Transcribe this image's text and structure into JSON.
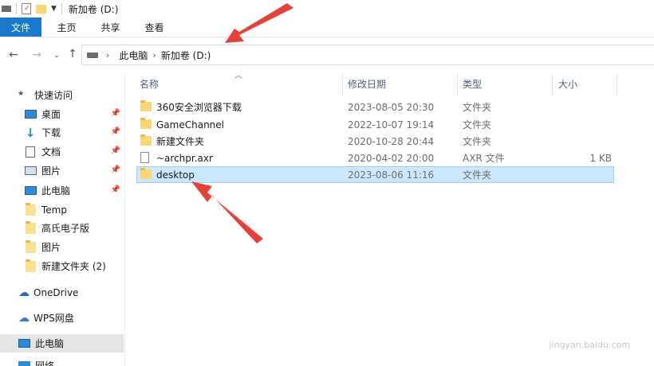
{
  "window": {
    "title": "新加卷 (D:)"
  },
  "ribbon": {
    "tabs": [
      {
        "label": "文件"
      },
      {
        "label": "主页"
      },
      {
        "label": "共享"
      },
      {
        "label": "查看"
      }
    ]
  },
  "address": {
    "segments": [
      "此电脑",
      "新加卷 (D:)"
    ]
  },
  "sidebar": {
    "quick_access": "快速访问",
    "items": [
      {
        "label": "桌面",
        "icon": "desktop-icon",
        "pinned": true
      },
      {
        "label": "下载",
        "icon": "download-icon",
        "pinned": true
      },
      {
        "label": "文档",
        "icon": "document-icon",
        "pinned": true
      },
      {
        "label": "图片",
        "icon": "pictures-icon",
        "pinned": true
      },
      {
        "label": "此电脑",
        "icon": "computer-icon",
        "pinned": true
      },
      {
        "label": "Temp",
        "icon": "folder-icon",
        "pinned": false
      },
      {
        "label": "高氏电子版",
        "icon": "folder-icon",
        "pinned": false
      },
      {
        "label": "图片",
        "icon": "folder-icon",
        "pinned": false
      },
      {
        "label": "新建文件夹 (2)",
        "icon": "folder-icon",
        "pinned": false
      }
    ],
    "onedrive": "OneDrive",
    "wps": "WPS网盘",
    "this_pc": "此电脑",
    "next_partial": "网络"
  },
  "columns": {
    "name": "名称",
    "date": "修改日期",
    "type": "类型",
    "size": "大小"
  },
  "files": [
    {
      "name": "360安全浏览器下载",
      "date": "2023-08-05 20:30",
      "type": "文件夹",
      "size": "",
      "kind": "folder"
    },
    {
      "name": "GameChannel",
      "date": "2022-10-07 19:14",
      "type": "文件夹",
      "size": "",
      "kind": "folder"
    },
    {
      "name": "新建文件夹",
      "date": "2020-10-28 20:44",
      "type": "文件夹",
      "size": "",
      "kind": "folder"
    },
    {
      "name": "~archpr.axr",
      "date": "2020-04-02 20:00",
      "type": "AXR 文件",
      "size": "1 KB",
      "kind": "file"
    },
    {
      "name": "desktop",
      "date": "2023-08-06 11:16",
      "type": "文件夹",
      "size": "",
      "kind": "folder",
      "selected": true
    }
  ],
  "colors": {
    "accent": "#1979ca",
    "selection_bg": "#cce8ff",
    "selection_border": "#99d1ff",
    "annotation_arrow": "#e8413a"
  },
  "watermark": "jingyan.baidu.com"
}
